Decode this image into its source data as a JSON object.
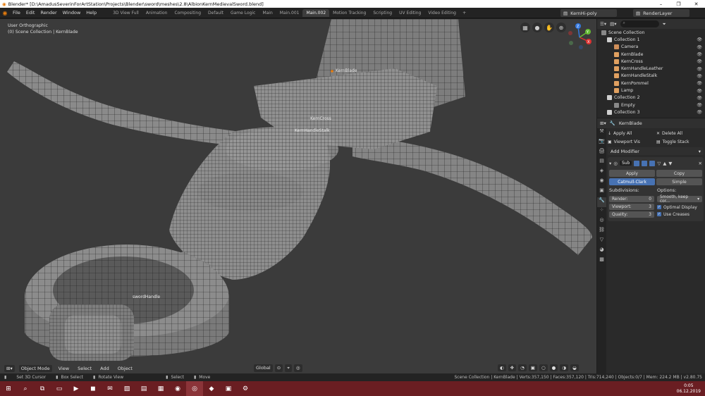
{
  "window": {
    "title": "Blender* [D:\\AmadusSeverinForArtStation\\Projects\\Blender\\sword\\meshes\\2.8\\AlbionKernMedievalSword.blend]",
    "minimize": "–",
    "maximize": "❐",
    "close": "✕"
  },
  "menu": [
    "File",
    "Edit",
    "Render",
    "Window",
    "Help"
  ],
  "workspace_tabs": [
    "3D View Full",
    "Animation",
    "Compositing",
    "Default",
    "Game Logic",
    "Main",
    "Main.001",
    "Main.002",
    "Motion Tracking",
    "Scripting",
    "UV Editing",
    "Video Editing"
  ],
  "active_tab": "Main.002",
  "scene": "KernHi-poly",
  "view_layer": "RenderLayer",
  "viewport": {
    "view_name": "User Orthographic",
    "collection_info": "(0) Scene Collection | KernBlade",
    "labels": [
      "KernBlade",
      "KernCross",
      "KernHandleStalk",
      "swordHandle"
    ],
    "gizmo": {
      "x": "X",
      "y": "Y",
      "z": "Z"
    }
  },
  "viewport_header": {
    "mode": "Object Mode",
    "menus": [
      "View",
      "Select",
      "Add",
      "Object"
    ],
    "transform": "Global"
  },
  "outliner": {
    "root": "Scene Collection",
    "items": [
      {
        "label": "Collection 1",
        "color": "#cfcfcf"
      },
      {
        "label": "Camera",
        "color": "#cf8f5a"
      },
      {
        "label": "KernBlade",
        "color": "#e0a060"
      },
      {
        "label": "KernCross",
        "color": "#e0a060"
      },
      {
        "label": "KernHandleLeather",
        "color": "#e0a060"
      },
      {
        "label": "KernHandleStalk",
        "color": "#e0a060"
      },
      {
        "label": "KernPommel",
        "color": "#e0a060"
      },
      {
        "label": "Lamp",
        "color": "#e0a060"
      },
      {
        "label": "Collection 2",
        "color": "#cfcfcf"
      },
      {
        "label": "Empty",
        "color": "#888888"
      },
      {
        "label": "Collection 3",
        "color": "#cfcfcf"
      }
    ]
  },
  "properties": {
    "object": "KernBlade",
    "apply_all": "Apply All",
    "delete_all": "Delete All",
    "viewport_vis": "Viewport Vis",
    "toggle_stack": "Toggle Stack",
    "add_modifier": "Add Modifier",
    "modifier_name": "Sub",
    "apply": "Apply",
    "copy": "Copy",
    "catmull": "Catmull-Clark",
    "simple": "Simple",
    "subdivisions_label": "Subdivisions:",
    "options_label": "Options:",
    "render_label": "Render:",
    "render_value": "0",
    "viewport_label": "Viewport:",
    "viewport_value": "3",
    "quality_label": "Quality:",
    "quality_value": "3",
    "uv_smooth": "Smooth, keep cor...",
    "optimal_display": "Optimal Display",
    "use_creases": "Use Creases"
  },
  "statusbar": {
    "set_cursor": "Set 3D Cursor",
    "box_select": "Box Select",
    "rotate_view": "Rotate View",
    "select": "Select",
    "move": "Move",
    "stats": "Scene Collection | KernBlade | Verts:357,150 | Faces:357,120 | Tris:714,240 | Objects:0/7 | Mem: 224.2 MB | v2.80.75"
  },
  "taskbar": {
    "time": "0:05",
    "date": "06.12.2019"
  },
  "colors": {
    "accent": "#4772b3",
    "viewport_bg": "#3b3b3b",
    "taskbar": "#6a1e22"
  }
}
